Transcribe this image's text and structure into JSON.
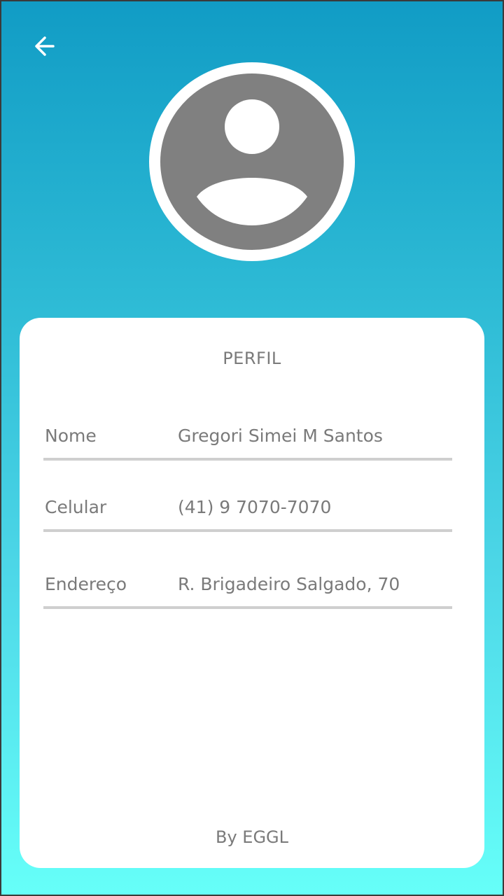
{
  "header": {
    "back_icon": "arrow-left-icon",
    "avatar_icon": "user-placeholder-icon"
  },
  "profile": {
    "title": "PERFIL",
    "fields": [
      {
        "label": "Nome",
        "value": "Gregori Simei M Santos"
      },
      {
        "label": "Celular",
        "value": "(41) 9 7070-7070"
      },
      {
        "label": "Endereço",
        "value": "R. Brigadeiro Salgado, 70"
      }
    ]
  },
  "footer": {
    "credit": "By EGGL"
  },
  "colors": {
    "gradient_top": "#119cc5",
    "gradient_bottom": "#66fff9",
    "text": "#7a7a7a",
    "divider": "#cfcfcf",
    "avatar": "#808080"
  }
}
